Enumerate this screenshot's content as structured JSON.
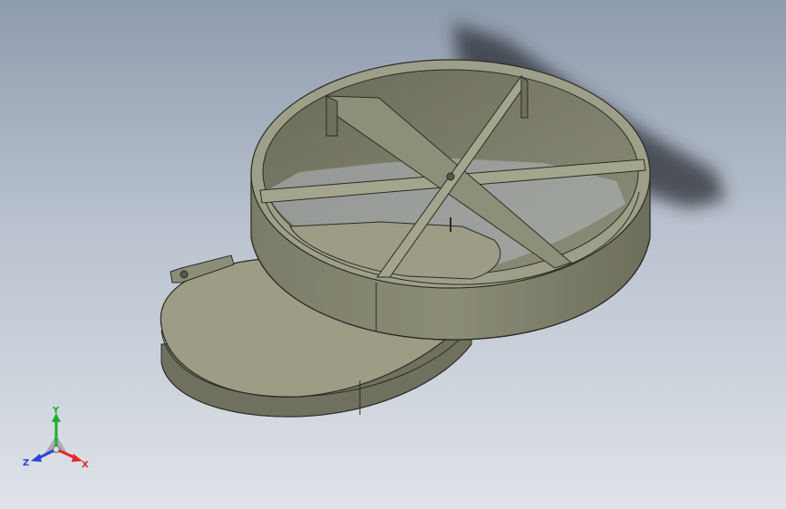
{
  "triad": {
    "x_label": "X",
    "y_label": "Y",
    "z_label": "Z"
  },
  "colors": {
    "background_top": "#8f9cae",
    "background_bottom": "#dfe3e9",
    "part_face": "#9d9d86",
    "part_dark": "#6e6f5d",
    "part_edge": "#2b2b26",
    "x_axis": "#e0282a",
    "y_axis": "#1fae2c",
    "z_axis": "#2a45d8"
  }
}
